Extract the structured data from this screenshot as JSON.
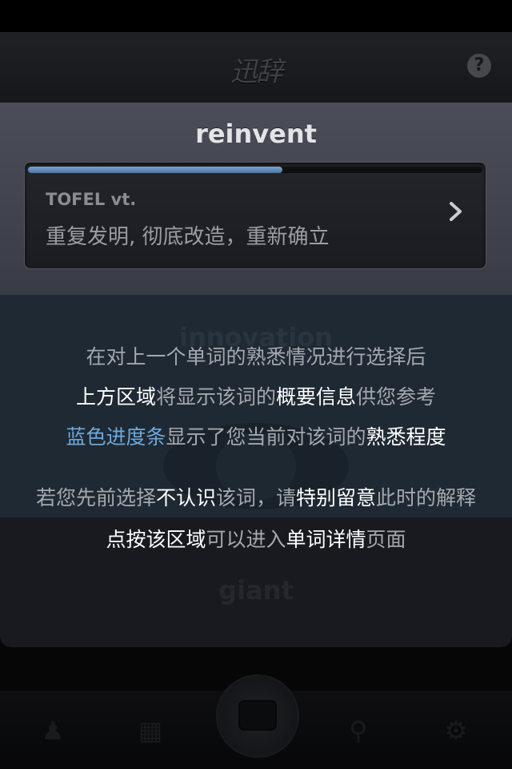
{
  "app": {
    "logo_text": "迅辞"
  },
  "header": {
    "help_label": "?"
  },
  "word_panel": {
    "word": "reinvent",
    "progress_fraction": 0.56,
    "tag": "TOFEL vt.",
    "definition": "重复发明, 彻底改造，重新确立"
  },
  "card": {
    "word_top": "innovation",
    "word_bottom": "giant"
  },
  "tips": {
    "line1": [
      {
        "t": "在对上一个单词的熟悉情况进行选择后",
        "s": "dim"
      }
    ],
    "line2": [
      {
        "t": "上方区域",
        "s": "hi"
      },
      {
        "t": "将显示该词的",
        "s": "dim"
      },
      {
        "t": "概要信息",
        "s": "hi"
      },
      {
        "t": "供您参考",
        "s": "dim"
      }
    ],
    "line3": [
      {
        "t": "蓝色进度条",
        "s": "blue"
      },
      {
        "t": "显示了您当前对该词的",
        "s": "dim"
      },
      {
        "t": "熟悉程度",
        "s": "hi"
      }
    ],
    "line4": [
      {
        "t": "若您先前选择",
        "s": "dim"
      },
      {
        "t": "不认识",
        "s": "hi"
      },
      {
        "t": "该词，请",
        "s": "dim"
      },
      {
        "t": "特别留意",
        "s": "hi"
      },
      {
        "t": "此时的解释",
        "s": "dim"
      }
    ],
    "line5": [
      {
        "t": "点按该区域",
        "s": "hi"
      },
      {
        "t": "可以进入",
        "s": "dim"
      },
      {
        "t": "单词详情",
        "s": "hi"
      },
      {
        "t": "页面",
        "s": "dim"
      }
    ]
  },
  "tabbar": {
    "icons": [
      "user-icon",
      "grid-icon",
      "search-icon",
      "gear-icon"
    ],
    "center": "flashcard-icon"
  },
  "colors": {
    "progress": "#5b86b4",
    "highlight_blue": "#6fa8dc"
  }
}
